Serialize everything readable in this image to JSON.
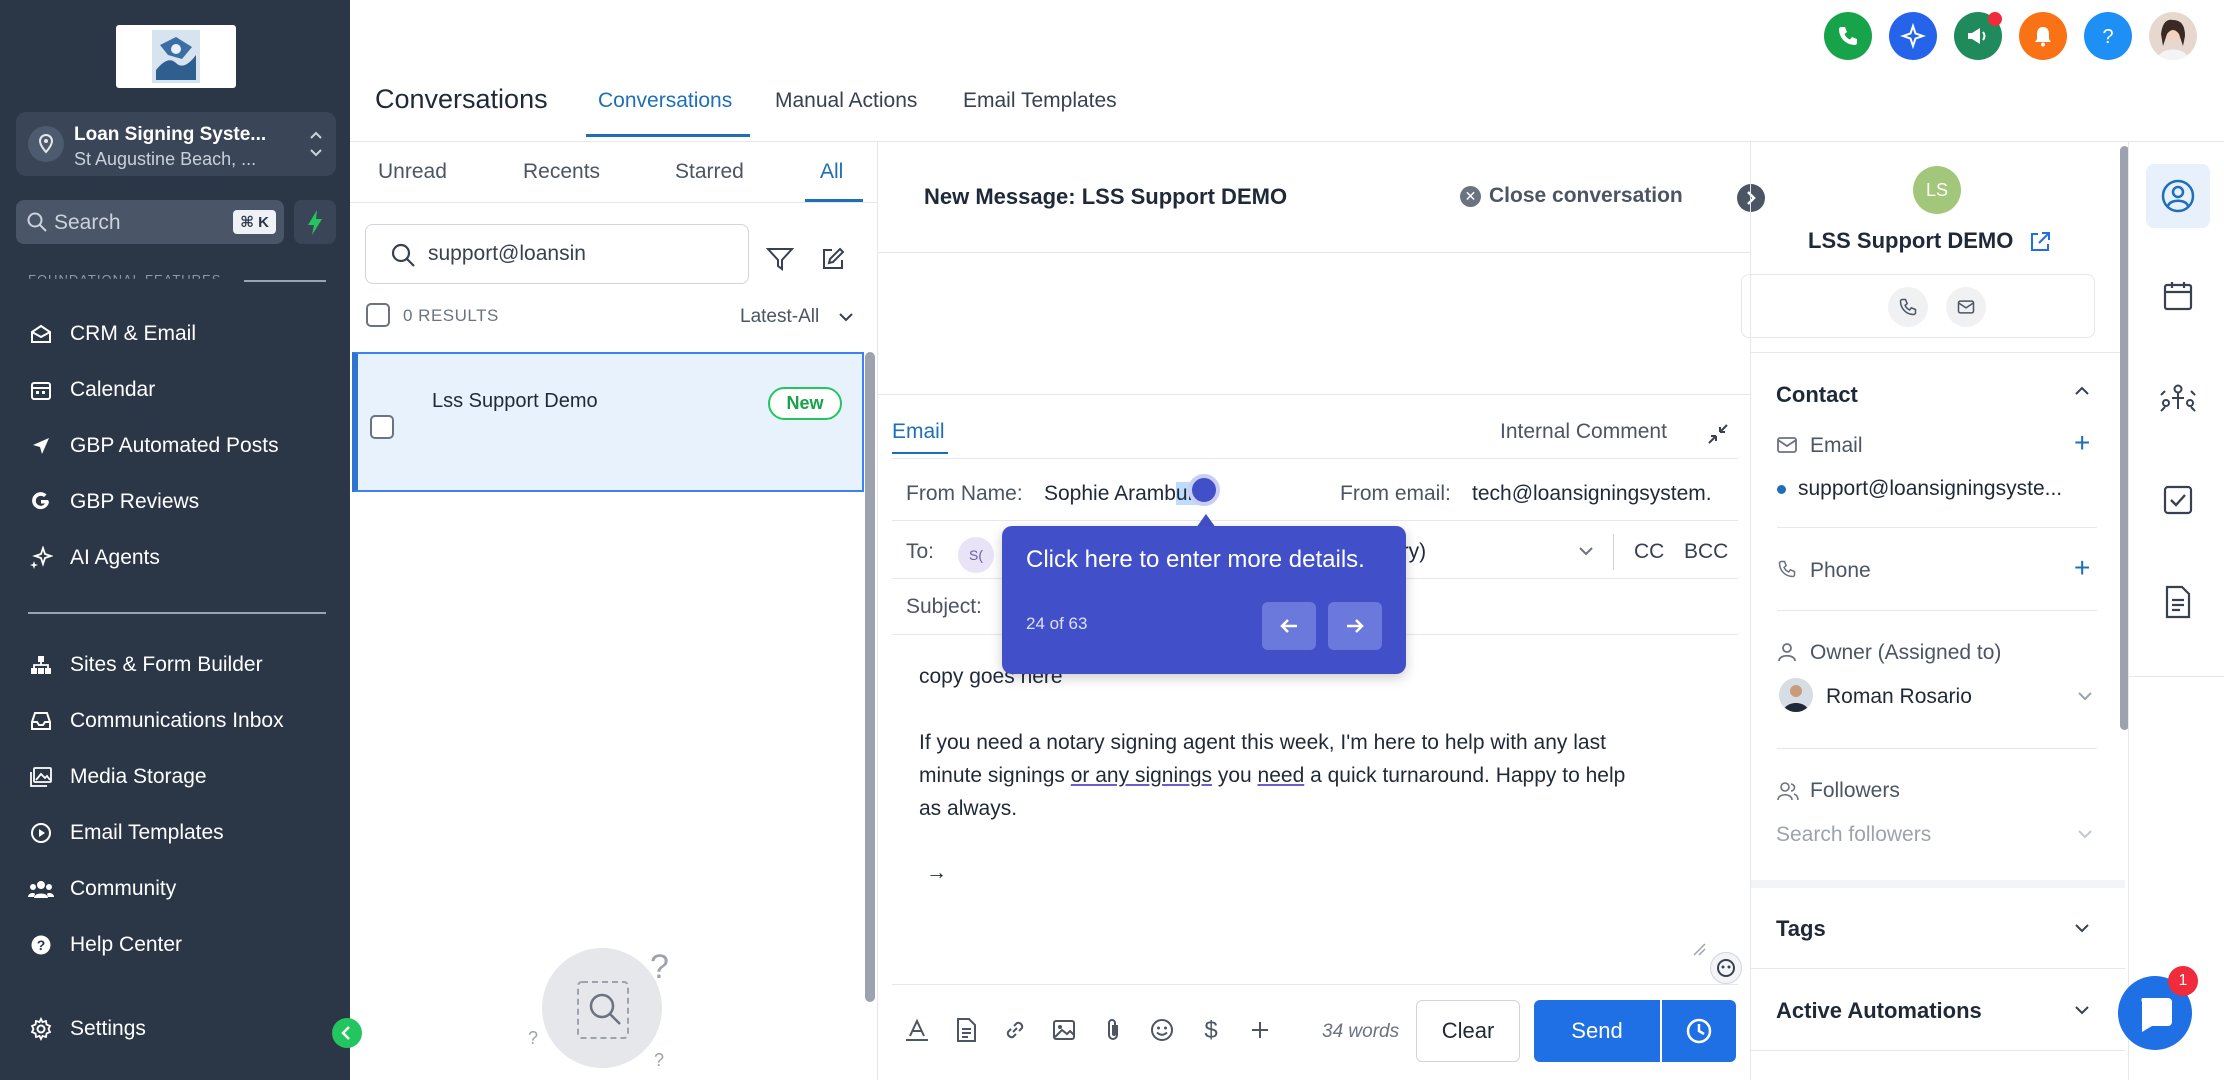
{
  "sidebar": {
    "account_name": "Loan Signing Syste...",
    "account_location": "St Augustine Beach, ...",
    "search_placeholder": "Search",
    "search_shortcut": "⌘ K",
    "section_label": "FOUNDATIONAL FEATURES",
    "items": [
      {
        "label": "CRM & Email",
        "icon": "mail-open-icon"
      },
      {
        "label": "Calendar",
        "icon": "calendar-icon"
      },
      {
        "label": "GBP Automated Posts",
        "icon": "send-icon"
      },
      {
        "label": "GBP Reviews",
        "icon": "google-icon"
      },
      {
        "label": "AI Agents",
        "icon": "sparkle-icon"
      },
      {
        "label": "Sites & Form Builder",
        "icon": "sitemap-icon"
      },
      {
        "label": "Communications Inbox",
        "icon": "inbox-icon"
      },
      {
        "label": "Media Storage",
        "icon": "images-icon"
      },
      {
        "label": "Email Templates",
        "icon": "play-circle-icon"
      },
      {
        "label": "Community",
        "icon": "users-icon"
      },
      {
        "label": "Help Center",
        "icon": "question-circle-icon"
      }
    ],
    "settings_label": "Settings"
  },
  "header": {
    "title": "Conversations",
    "tabs": [
      {
        "label": "Conversations",
        "active": true
      },
      {
        "label": "Manual Actions",
        "active": false
      },
      {
        "label": "Email Templates",
        "active": false
      }
    ]
  },
  "list": {
    "filters": [
      "Unread",
      "Recents",
      "Starred",
      "All"
    ],
    "active_filter": "All",
    "search_value": "support@loansin",
    "results": "0 RESULTS",
    "sort": "Latest-All",
    "conversations": [
      {
        "name": "Lss Support Demo",
        "badge": "New"
      }
    ]
  },
  "message": {
    "title": "New Message: LSS Support DEMO",
    "close_label": "Close conversation",
    "tab_email": "Email",
    "tab_internal": "Internal Comment",
    "from_name_label": "From Name:",
    "from_name_value": "Sophie Aramb",
    "from_name_value_hl": "urr",
    "from_email_label": "From email:",
    "from_email_value": "tech@loansigningsystem.",
    "to_label": "To:",
    "to_chip": "S(",
    "to_value_tail": "ary)",
    "cc": "CC",
    "bcc": "BCC",
    "subject_label": "Subject:",
    "body_line1": "copy goes here",
    "body_p2a": "If you need a notary signing agent this week, I'm here to help with any last",
    "body_p2b_1": "minute signings ",
    "body_p2b_u1": "or any signings",
    "body_p2b_2": " you ",
    "body_p2b_u2": "need",
    "body_p2b_3": " a quick turnaround. Happy to help",
    "body_p2c": "as always.",
    "arrow": "→",
    "word_count": "34 words",
    "clear_label": "Clear",
    "send_label": "Send"
  },
  "tooltip": {
    "text": "Click here to enter more details.",
    "progress": "24 of 63"
  },
  "contact": {
    "initials": "LS",
    "name": "LSS Support DEMO",
    "section_contact": "Contact",
    "email_label": "Email",
    "email_value": "support@loansigningsyste...",
    "phone_label": "Phone",
    "owner_label": "Owner (Assigned to)",
    "owner_value": "Roman Rosario",
    "followers_label": "Followers",
    "followers_placeholder": "Search followers",
    "tags_label": "Tags",
    "automations_label": "Active Automations"
  },
  "chat_badge": "1",
  "colors": {
    "sidebar_bg": "#2b3646",
    "accent": "#1d6fb8",
    "send": "#1f6fe5",
    "tooltip": "#4150c8",
    "new_badge": "#22c55e"
  }
}
